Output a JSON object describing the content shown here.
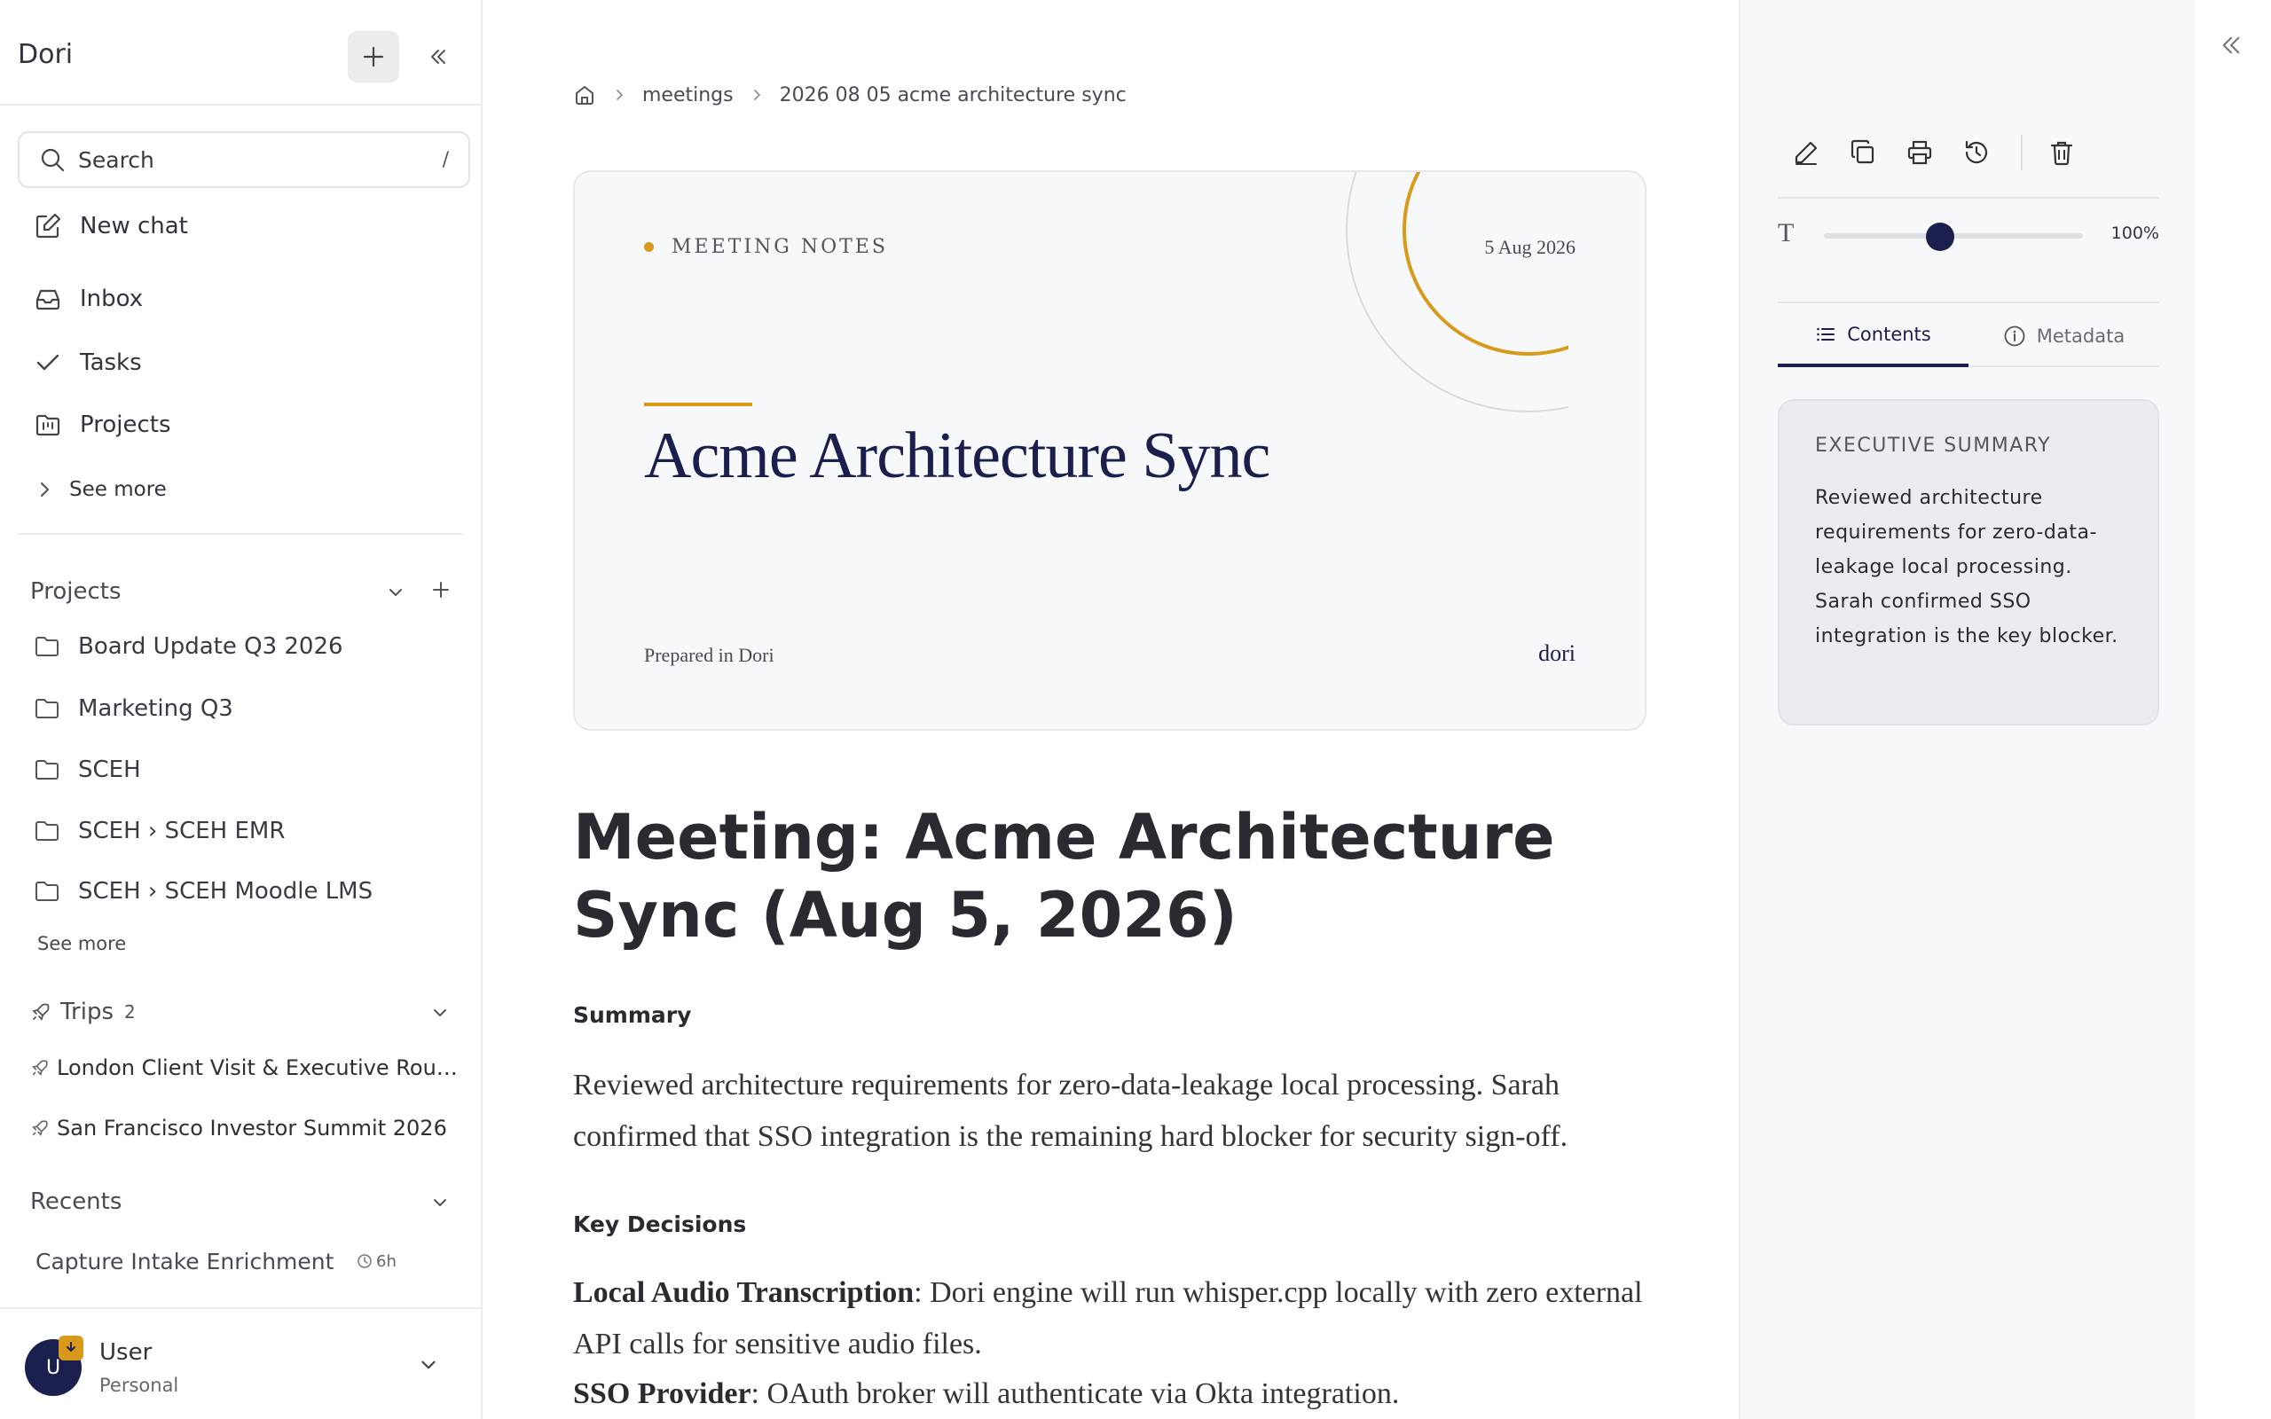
{
  "app": {
    "title": "Dori"
  },
  "search": {
    "label": "Search",
    "shortcut": "/"
  },
  "nav": {
    "new_chat": "New chat",
    "inbox": "Inbox",
    "tasks": "Tasks",
    "projects": "Projects",
    "see_more": "See more"
  },
  "projects_section": {
    "title": "Projects",
    "items": [
      {
        "label": "Board Update Q3 2026"
      },
      {
        "label": "Marketing Q3"
      },
      {
        "label": "SCEH"
      },
      {
        "label": "SCEH › SCEH EMR"
      },
      {
        "label": "SCEH › SCEH Moodle LMS"
      }
    ],
    "see_more": "See more"
  },
  "trips_section": {
    "title": "Trips",
    "count": "2",
    "items": [
      {
        "label": "London Client Visit & Executive Roundt..."
      },
      {
        "label": "San Francisco Investor Summit 2026"
      }
    ]
  },
  "recents_section": {
    "title": "Recents",
    "items": [
      {
        "label": "Capture Intake Enrichment",
        "age": "6h"
      }
    ]
  },
  "user": {
    "initial": "U",
    "name": "User",
    "plan": "Personal"
  },
  "breadcrumb": {
    "items": [
      "meetings",
      "2026 08 05 acme architecture sync"
    ]
  },
  "cover": {
    "kicker": "MEETING NOTES",
    "date": "5 Aug 2026",
    "title": "Acme Architecture Sync",
    "prepared": "Prepared in Dori",
    "brand": "dori"
  },
  "document": {
    "title": "Meeting: Acme Architecture Sync (Aug 5, 2026)",
    "summary_heading": "Summary",
    "summary_text": "Reviewed architecture requirements for zero-data-leakage local processing. Sarah confirmed that SSO integration is the remaining hard blocker for security sign-off.",
    "decisions_heading": "Key Decisions",
    "decisions": [
      {
        "term": "Local Audio Transcription",
        "text": ": Dori engine will run whisper.cpp locally with zero external API calls for sensitive audio files."
      },
      {
        "term": "SSO Provider",
        "text": ": OAuth broker will authenticate via Okta integration."
      }
    ]
  },
  "right_panel": {
    "zoom": {
      "value_label": "100%",
      "level": 0.45
    },
    "tabs": {
      "contents": "Contents",
      "metadata": "Metadata"
    },
    "summary_card": {
      "heading": "EXECUTIVE SUMMARY",
      "body": "Reviewed architecture requirements for zero-data-leakage local processing. Sarah confirmed SSO integration is the key blocker."
    }
  },
  "colors": {
    "accent": "#d99a1b",
    "navy": "#1b1f4d",
    "panel_bg": "#f7f8fa"
  },
  "icons": [
    "plus-icon",
    "double-chevron-left-icon",
    "search-icon",
    "edit-icon",
    "inbox-icon",
    "check-icon",
    "folder-icon",
    "chevron-right-icon",
    "chevron-down-icon",
    "rocket-icon",
    "clock-icon",
    "home-icon",
    "pencil-icon",
    "copy-icon",
    "print-icon",
    "history-icon",
    "trash-icon",
    "type-icon",
    "list-icon",
    "info-icon",
    "download-icon"
  ]
}
